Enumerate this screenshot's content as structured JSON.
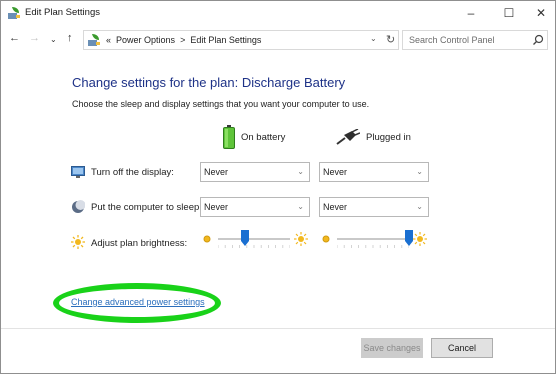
{
  "window": {
    "title": "Edit Plan Settings",
    "controls": {
      "minimize": "–",
      "maximize": "☐",
      "close": "✕"
    }
  },
  "nav": {
    "back": "←",
    "forward": "→",
    "recent": "⌄",
    "up": "↑",
    "breadcrumb_prefix": "«",
    "breadcrumb": [
      "Power Options",
      "Edit Plan Settings"
    ],
    "separator": ">",
    "dropdown": "⌄",
    "refresh": "↻",
    "search_placeholder": "Search Control Panel"
  },
  "main": {
    "heading": "Change settings for the plan: Discharge Battery",
    "subheading": "Choose the sleep and display settings that you want your computer to use.",
    "columns": {
      "battery": "On battery",
      "plugged": "Plugged in"
    },
    "rows": [
      {
        "label": "Turn off the display:",
        "battery": "Never",
        "plugged": "Never",
        "icon": "monitor-icon"
      },
      {
        "label": "Put the computer to sleep:",
        "battery": "Never",
        "plugged": "Never",
        "icon": "moon-icon"
      }
    ],
    "brightness": {
      "label": "Adjust plan brightness:",
      "battery_level": 0.38,
      "plugged_level": 1.0
    },
    "advanced_link": "Change advanced power settings"
  },
  "footer": {
    "save": "Save changes",
    "cancel": "Cancel"
  },
  "colors": {
    "heading": "#1e3287",
    "link": "#2a6ebc",
    "highlight_oval": "#19d219",
    "slider_thumb": "#1a6fd1"
  }
}
